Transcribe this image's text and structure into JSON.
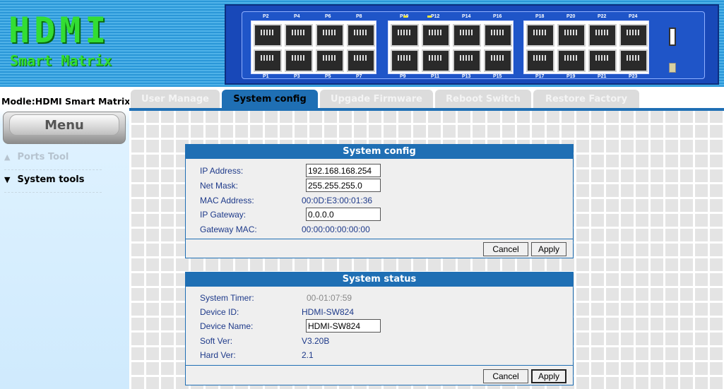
{
  "header": {
    "logo_main": "HDMI",
    "logo_sub": "Smart Matrix",
    "ports_top": [
      "P2",
      "P4",
      "P6",
      "P8",
      "P10",
      "P12",
      "P14",
      "P16",
      "P18",
      "P20",
      "P22",
      "P24"
    ],
    "ports_bottom": [
      "P1",
      "P3",
      "P5",
      "P7",
      "P9",
      "P11",
      "P13",
      "P15",
      "P17",
      "P19",
      "P21",
      "P23"
    ]
  },
  "sidebar": {
    "model": "Modle:HDMI Smart Matrix",
    "menu_label": "Menu",
    "items": [
      {
        "label": "Ports Tool",
        "arrow": "▲"
      },
      {
        "label": "System tools",
        "arrow": "▼"
      }
    ]
  },
  "tabs": [
    {
      "label": "User Manage",
      "active": false
    },
    {
      "label": "System config",
      "active": true
    },
    {
      "label": "Upgade Firmware",
      "active": false
    },
    {
      "label": "Reboot Switch",
      "active": false
    },
    {
      "label": "Restore Factory",
      "active": false
    }
  ],
  "system_config": {
    "title": "System config",
    "ip_address_label": "IP Address:",
    "ip_address_value": "192.168.168.254",
    "net_mask_label": "Net Mask:",
    "net_mask_value": "255.255.255.0",
    "mac_address_label": "MAC Address:",
    "mac_address_value": "00:0D:E3:00:01:36",
    "ip_gateway_label": "IP Gateway:",
    "ip_gateway_value": "0.0.0.0",
    "gateway_mac_label": "Gateway MAC:",
    "gateway_mac_value": "00:00:00:00:00:00",
    "cancel_label": "Cancel",
    "apply_label": "Apply"
  },
  "system_status": {
    "title": "System status",
    "timer_label": "System Timer:",
    "timer_value": "00-01:07:59",
    "device_id_label": "Device ID:",
    "device_id_value": "HDMI-SW824",
    "device_name_label": "Device Name:",
    "device_name_value": "HDMI-SW824",
    "soft_ver_label": "Soft Ver:",
    "soft_ver_value": "V3.20B",
    "hard_ver_label": "Hard Ver:",
    "hard_ver_value": "2.1",
    "cancel_label": "Cancel",
    "apply_label": "Apply"
  },
  "colors": {
    "accent": "#1f6fb4",
    "logo_green": "#33dd33",
    "header_blue": "#2a97d8",
    "led_yellow": "#f2e63a"
  }
}
